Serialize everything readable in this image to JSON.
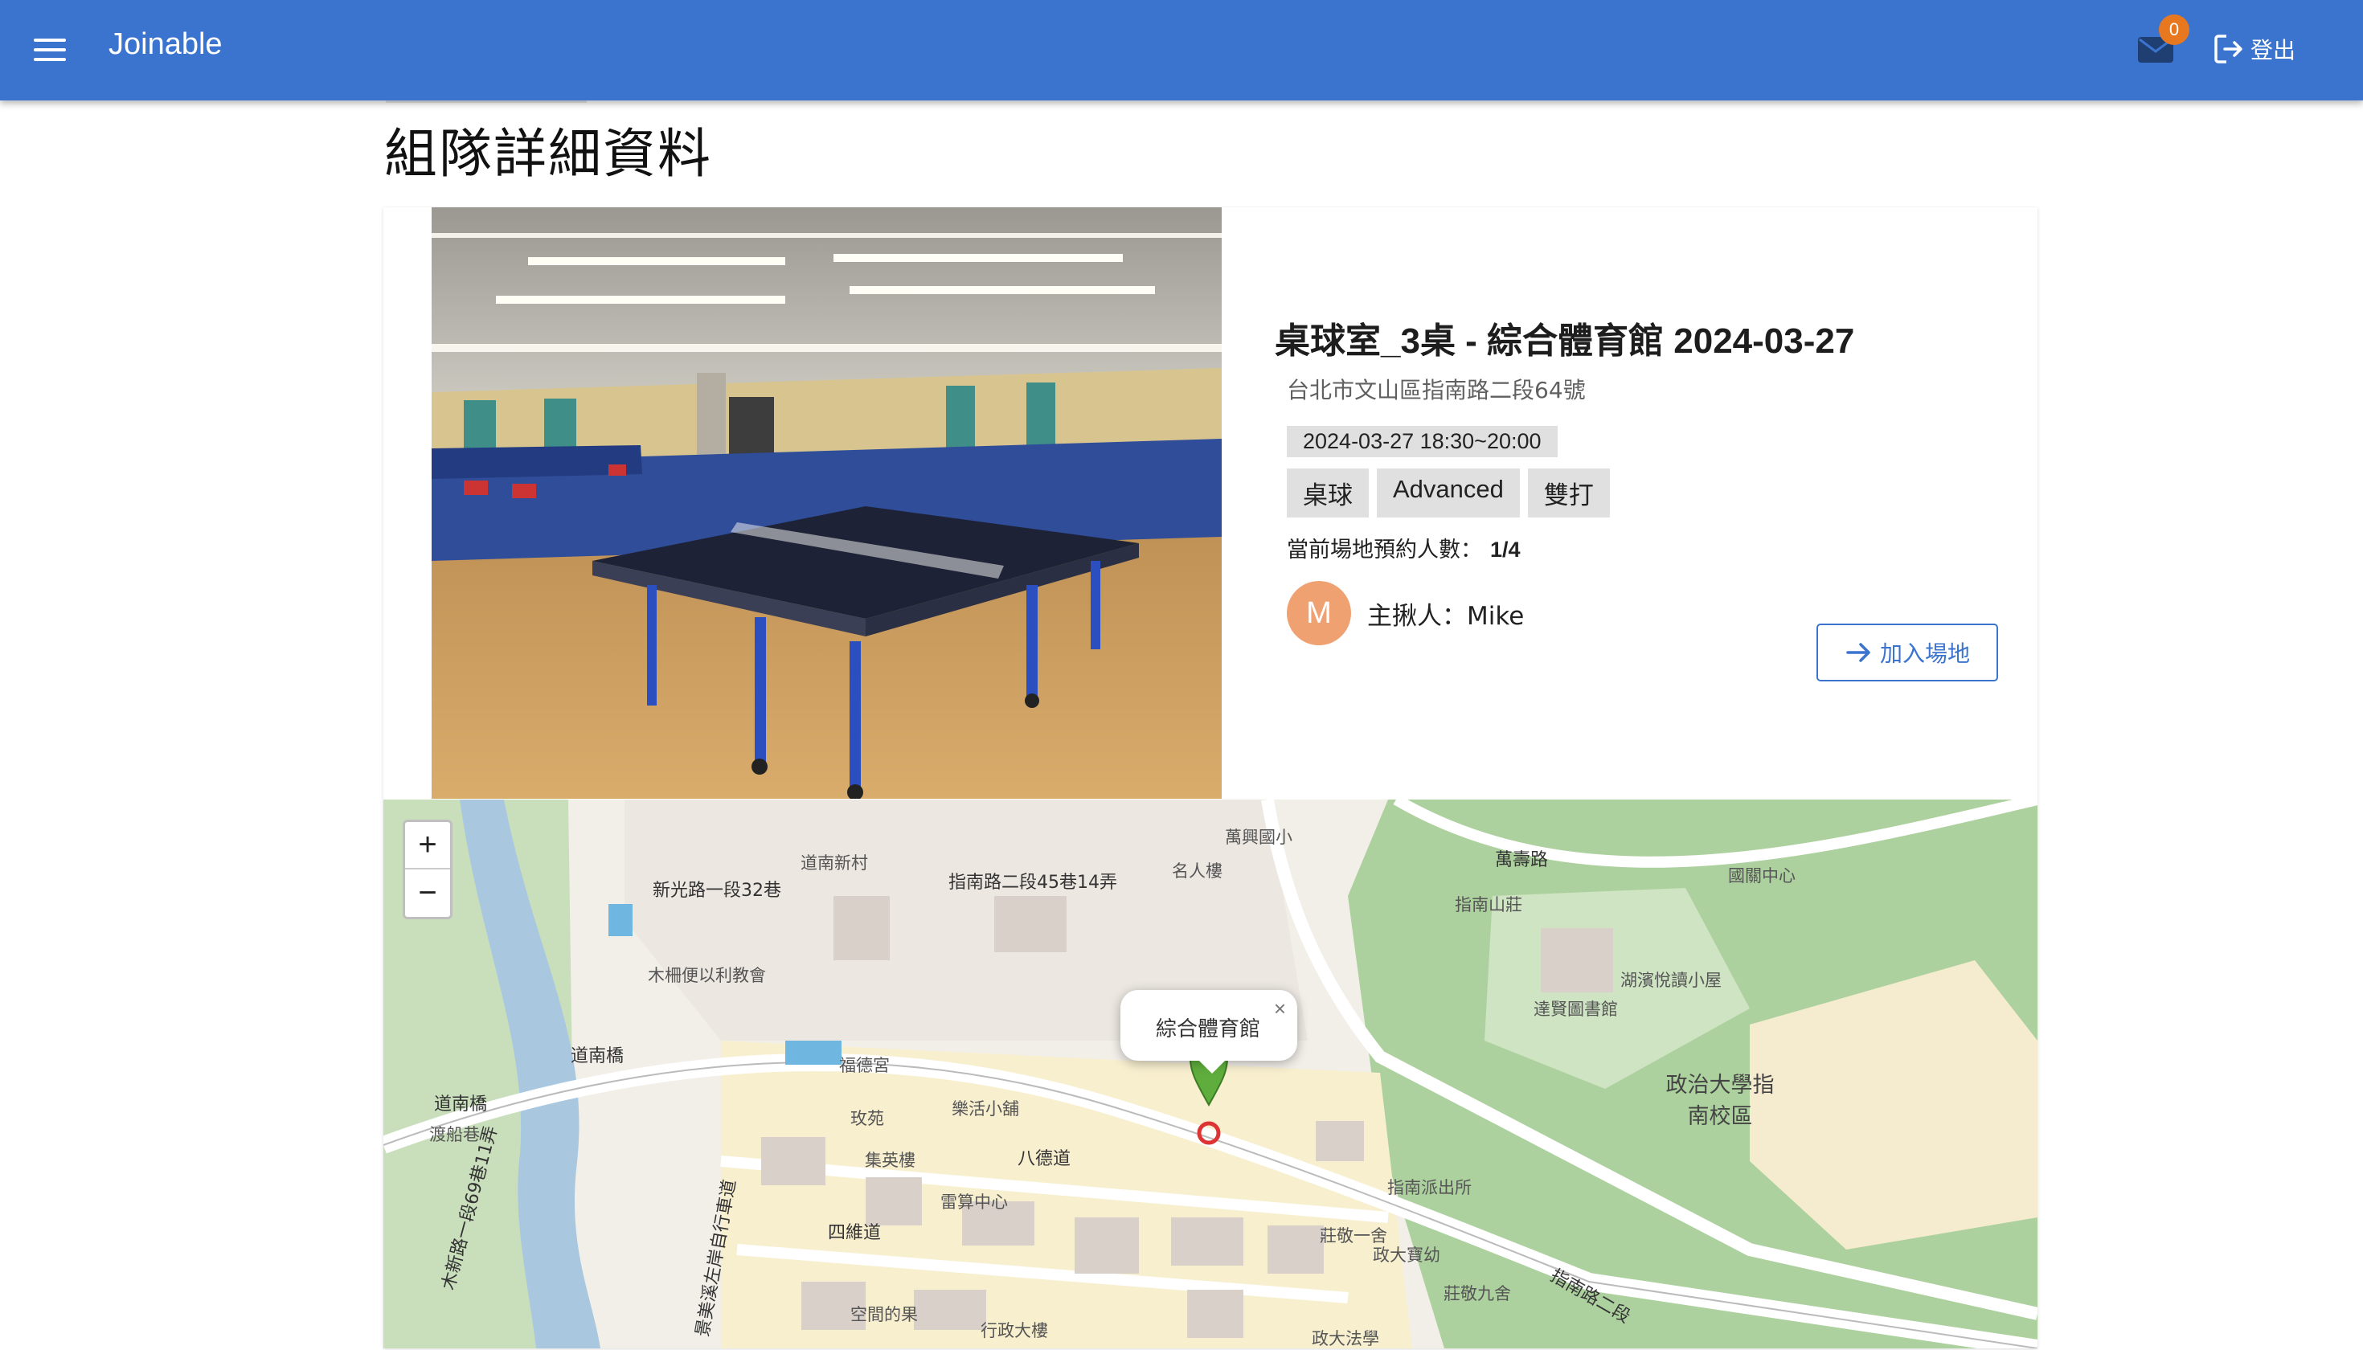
{
  "app": {
    "title": "Joinable",
    "mail_count": "0",
    "logout_label": "登出"
  },
  "page": {
    "title": "組隊詳細資料"
  },
  "event": {
    "title": "桌球室_3桌 - 綜合體育館 2024-03-27",
    "address": "台北市文山區指南路二段64號",
    "datetime": "2024-03-27 18:30~20:00",
    "tags": [
      "桌球",
      "Advanced",
      "雙打"
    ],
    "count_label": "當前場地預約人數：",
    "count_value": "1/4",
    "host_initial": "M",
    "host_label": "主揪人：Mike",
    "join_label": "加入場地"
  },
  "map": {
    "zoom_in": "+",
    "zoom_out": "−",
    "popup_text": "綜合體育館",
    "popup_close": "×",
    "labels": [
      "新光路一段32巷",
      "道南新村",
      "指南路二段45巷14弄",
      "名人樓",
      "萬興國小",
      "萬壽路",
      "指南山莊",
      "國關中心",
      "木柵便以利教會",
      "道南橋",
      "渡船巷",
      "福德宮",
      "玫苑",
      "集英樓",
      "樂活小舖",
      "八德道",
      "四維道",
      "雷算中心",
      "空間的果",
      "行政大樓",
      "政治大學指南校區",
      "達賢圖書館",
      "湖濱悅讀小屋",
      "指南派出所",
      "莊敬一舍",
      "莊敬九舍",
      "政大寶幼",
      "木新路一段69巷11弄",
      "景美溪左岸自行車道",
      "指南路二段",
      "政大法學",
      "道南橋"
    ]
  },
  "colors": {
    "appbar": "#3b74cf",
    "badge": "#e8781f",
    "avatar": "#f0a172",
    "marker": "#5fad3d"
  },
  "icons": {
    "menu": "menu-icon",
    "mail": "mail-icon",
    "logout": "logout-icon",
    "join": "arrow-right-icon"
  }
}
